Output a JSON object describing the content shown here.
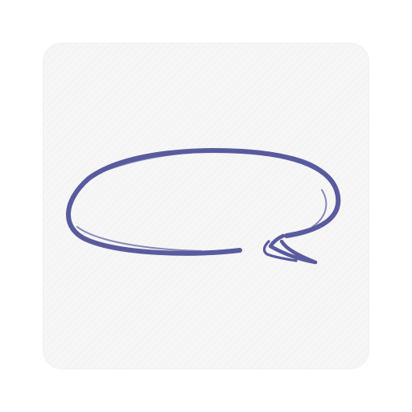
{
  "icon": {
    "name": "speech-bubble-icon",
    "stroke_color": "#5a5a9e",
    "tile_color": "#f6f6f7",
    "background_color": "#ffffff"
  }
}
